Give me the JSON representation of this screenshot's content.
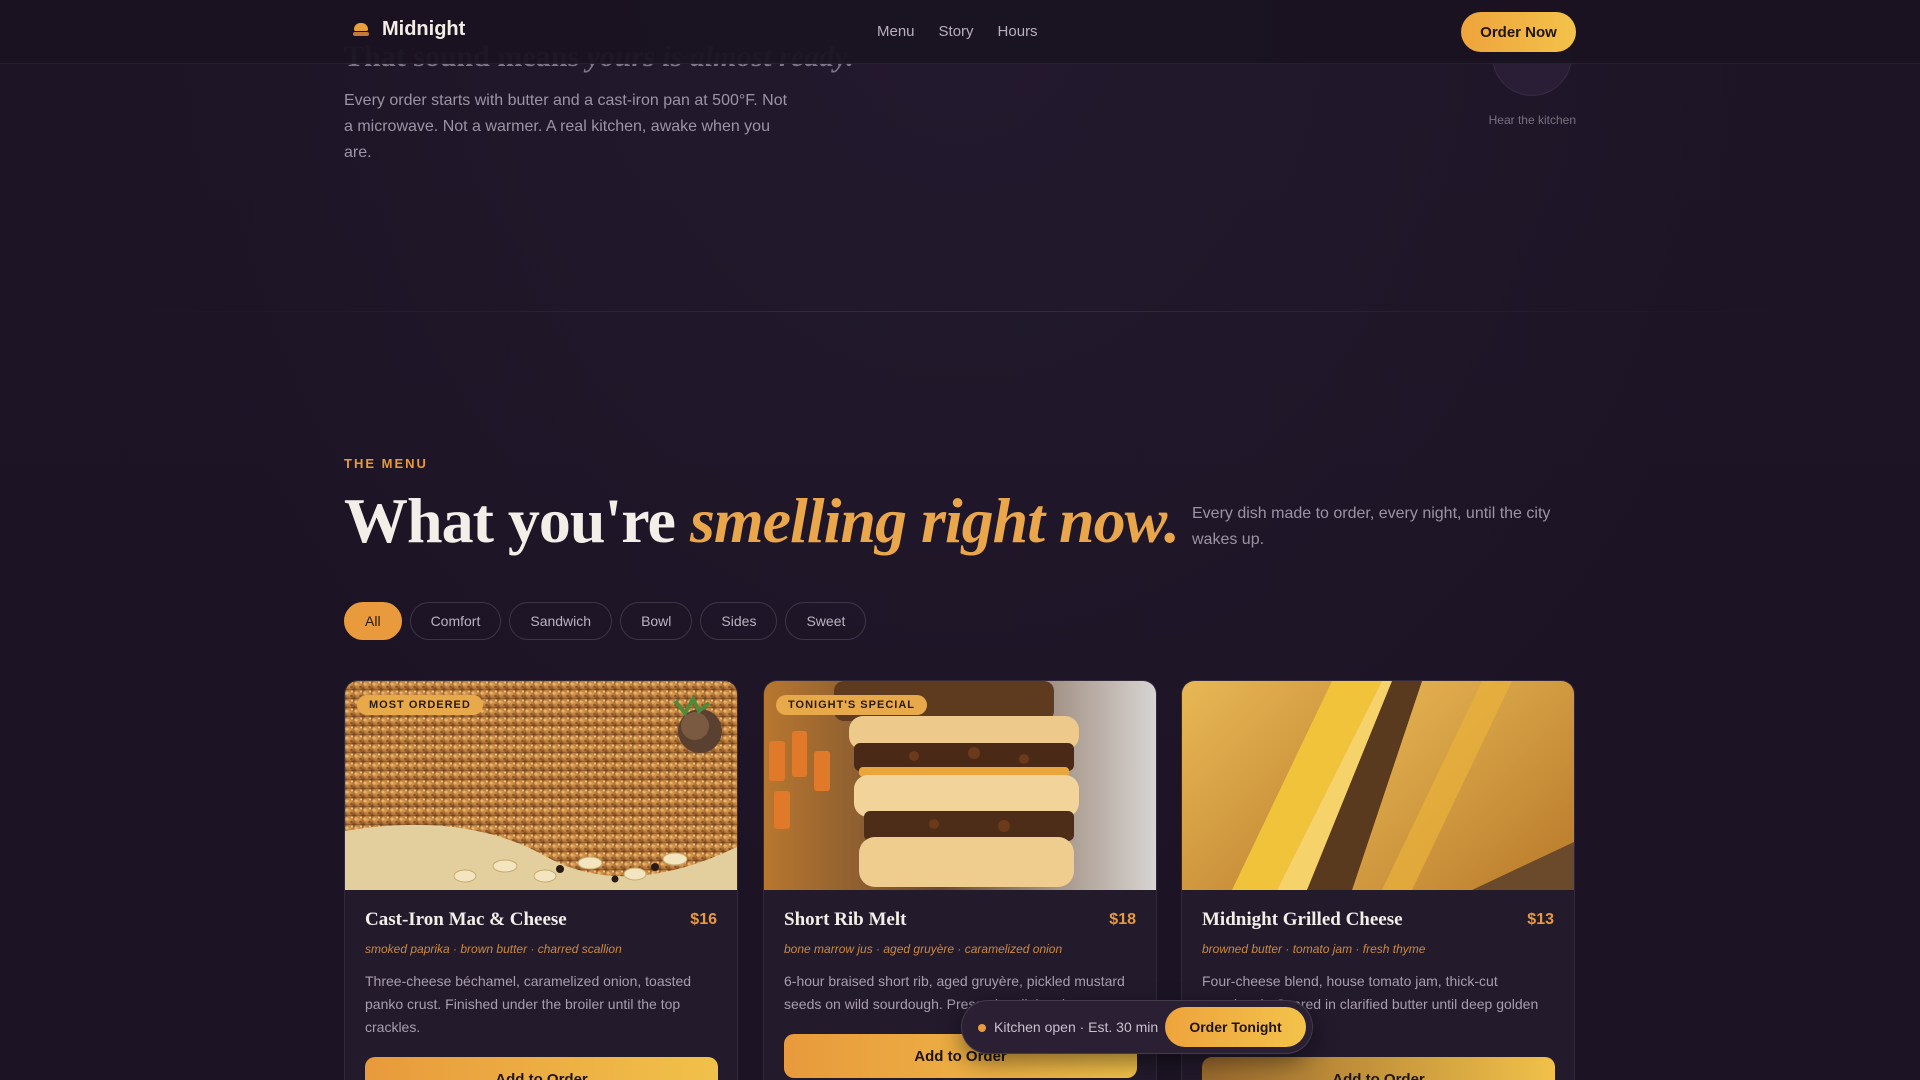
{
  "nav": {
    "brand": "Midnight",
    "links": [
      "Menu",
      "Story",
      "Hours"
    ],
    "cta": "Order Now"
  },
  "hero": {
    "title_plain": "That sound means ",
    "title_em": "yours is almost ready.",
    "body": "Every order starts with butter and a cast-iron pan at 500°F. Not a microwave. Not a warmer. A real kitchen, awake when you are.",
    "hear_label": "Hear the kitchen"
  },
  "menu": {
    "eyebrow": "THE MENU",
    "title_plain": "What you're ",
    "title_em": "smelling right now.",
    "subtitle": "Every dish made to order, every night, until the city wakes up.",
    "filters": [
      "All",
      "Comfort",
      "Sandwich",
      "Bowl",
      "Sides",
      "Sweet"
    ],
    "active_filter": "All",
    "items": [
      {
        "badge": "MOST ORDERED",
        "name": "Cast-Iron Mac & Cheese",
        "price": "$16",
        "tags": "smoked paprika · brown butter · charred scallion",
        "description": "Three-cheese béchamel, caramelized onion, toasted panko crust. Finished under the broiler until the top crackles.",
        "button": "Add to Order"
      },
      {
        "badge": "TONIGHT'S SPECIAL",
        "name": "Short Rib Melt",
        "price": "$18",
        "tags": "bone marrow jus · aged gruyère · caramelized onion",
        "description": "6-hour braised short rib, aged gruyère, pickled mustard seeds on wild sourdough. Pressed until the cheese...",
        "button": "Add to Order"
      },
      {
        "badge": "",
        "name": "Midnight Grilled Cheese",
        "price": "$13",
        "tags": "browned butter · tomato jam · fresh thyme",
        "description": "Four-cheese blend, house tomato jam, thick-cut sourdough. Seared in clarified butter until deep golden brown.",
        "button": "Add to Order"
      }
    ]
  },
  "status": {
    "text": "Kitchen open · Est. 30 min",
    "button": "Order Tonight"
  },
  "colors": {
    "background": "#1c1424",
    "accent": "#e89a3c",
    "accent_light": "#f3c24a"
  }
}
